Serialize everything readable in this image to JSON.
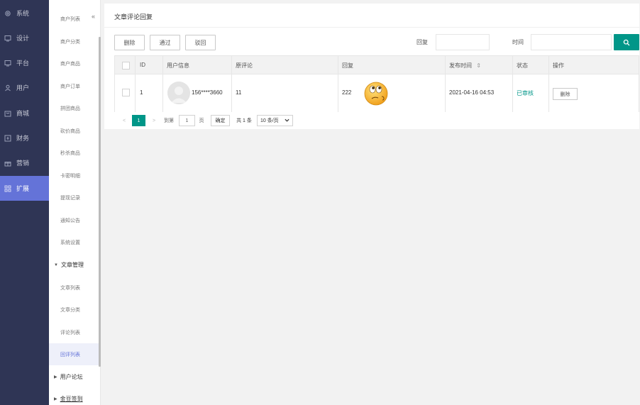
{
  "nav": {
    "items": [
      {
        "label": "系统",
        "icon": "gear-icon"
      },
      {
        "label": "设计",
        "icon": "monitor-icon"
      },
      {
        "label": "平台",
        "icon": "monitor-icon"
      },
      {
        "label": "用户",
        "icon": "user-icon"
      },
      {
        "label": "商城",
        "icon": "shop-icon"
      },
      {
        "label": "财务",
        "icon": "finance-icon"
      },
      {
        "label": "营销",
        "icon": "gift-icon"
      },
      {
        "label": "扩展",
        "icon": "grid-icon"
      }
    ],
    "active_index": 7
  },
  "sub": {
    "collapse_icon": "«",
    "items": [
      {
        "label": "商户列表"
      },
      {
        "label": "商户分类"
      },
      {
        "label": "商户商品"
      },
      {
        "label": "商户订单"
      },
      {
        "label": "拼团商品"
      },
      {
        "label": "砍价商品"
      },
      {
        "label": "秒杀商品"
      },
      {
        "label": "卡密明细"
      },
      {
        "label": "提现记录"
      },
      {
        "label": "通知公告"
      },
      {
        "label": "系统设置"
      },
      {
        "label": "文章管理",
        "group": true,
        "arrow": "▼"
      },
      {
        "label": "文章列表"
      },
      {
        "label": "文章分类"
      },
      {
        "label": "评论列表"
      },
      {
        "label": "回评列表",
        "active": true
      },
      {
        "label": "用户论坛",
        "group": true,
        "arrow": "▶"
      },
      {
        "label": "金豆签到",
        "group": true,
        "arrow": "▶"
      }
    ]
  },
  "panel": {
    "title": "文章评论回复",
    "toolbar": {
      "delete_label": "删除",
      "approve_label": "通过",
      "reject_label": "驳回",
      "reply_label": "回复",
      "time_label": "时间",
      "reply_value": "",
      "time_value": ""
    },
    "table": {
      "headers": [
        "ID",
        "用户信息",
        "原评论",
        "回复",
        "发布时间",
        "状态",
        "操作"
      ],
      "sort_indicator": "⇕",
      "rows": [
        {
          "id": "1",
          "user": "156****3660",
          "original": "11",
          "reply": "222",
          "time": "2021-04-16 04:53",
          "status": "已审核",
          "action": "删除"
        }
      ],
      "status_color": "#009688"
    },
    "pager": {
      "prev": "<",
      "current": "1",
      "next": ">",
      "goto_label": "到第",
      "goto_value": "1",
      "page_label": "页",
      "confirm_label": "确定",
      "total_label": "共 1 条",
      "per_page": "10 条/页"
    }
  },
  "colors": {
    "nav_bg": "#2f3555",
    "nav_active": "#6473d8",
    "accent": "#009688"
  }
}
